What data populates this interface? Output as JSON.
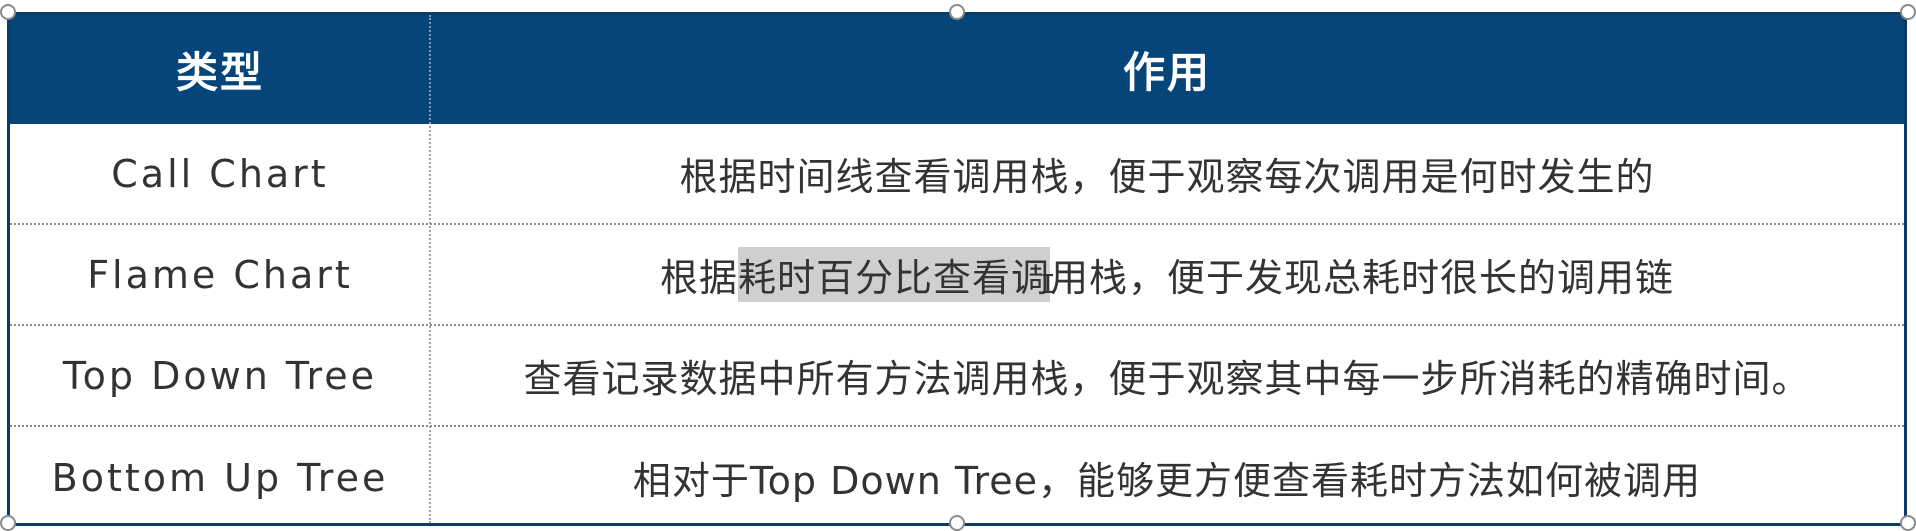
{
  "table": {
    "headers": [
      "类型",
      "作用"
    ],
    "rows": [
      {
        "type": "Call Chart",
        "purpose": "根据时间线查看调用栈，便于观察每次调用是何时发生的"
      },
      {
        "type": "Flame Chart",
        "purpose_before": "根据",
        "purpose_highlight": "耗时百分比查看调",
        "purpose_after": "用栈，便于发现总耗时很长的调用链"
      },
      {
        "type": "Top Down Tree",
        "purpose": "查看记录数据中所有方法调用栈，便于观察其中每一步所消耗的精确时间。"
      },
      {
        "type": "Bottom Up Tree",
        "purpose": "相对于Top Down Tree，能够更方便查看耗时方法如何被调用"
      }
    ]
  },
  "colors": {
    "header_bg": "#064579",
    "header_text": "#ffffff",
    "body_text": "#333333",
    "border": "#0a3a66",
    "selection_highlight": "#cfcfcf"
  },
  "icons": {
    "cursor": "text-cursor-icon",
    "handles": "resize-handle-icon"
  }
}
